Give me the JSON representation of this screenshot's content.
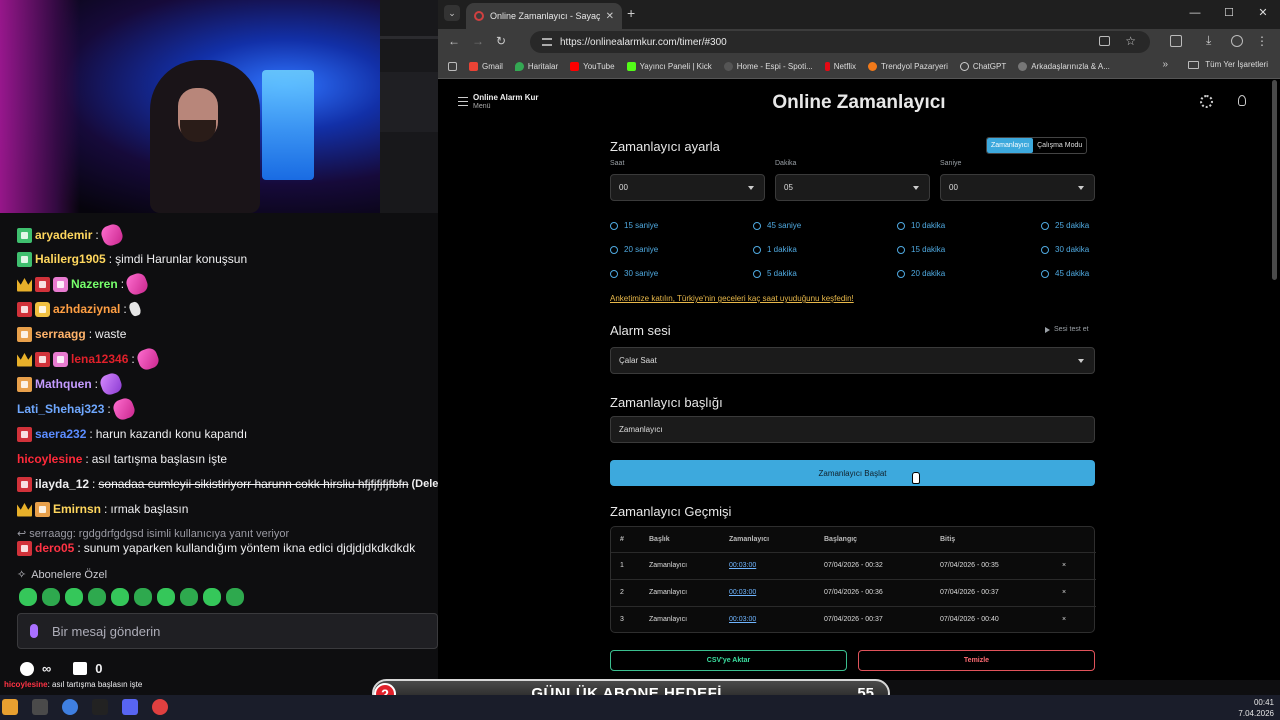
{
  "browser": {
    "tab_title": "Online Zamanlayıcı - Sayaç",
    "url": "https://onlinealarmkur.com/timer/#300",
    "bookmarks": [
      "Gmail",
      "Haritalar",
      "YouTube",
      "Yayıncı Paneli | Kick",
      "Home - Espi - Spoti...",
      "Netflix",
      "Trendyol Pazaryeri",
      "ChatGPT",
      "Arkadaşlarınızla & A..."
    ],
    "all_bookmarks": "Tüm Yer İşaretleri"
  },
  "page": {
    "brand": "Online Alarm Kur",
    "brand_sub": "Menü",
    "title": "Online Zamanlayıcı",
    "timer_heading": "Zamanlayıcı ayarla",
    "mode_timer": "Zamanlayıcı",
    "mode_work": "Çalışma Modu",
    "label_hour": "Saat",
    "label_minute": "Dakika",
    "label_second": "Saniye",
    "hour": "00",
    "minute": "05",
    "second": "00",
    "presets": [
      "15 saniye",
      "45 saniye",
      "10 dakika",
      "25 dakika",
      "20 saniye",
      "1 dakika",
      "15 dakika",
      "30 dakika",
      "30 saniye",
      "5 dakika",
      "20 dakika",
      "45 dakika"
    ],
    "survey_link": "Anketimize katılın, Türkiye'nin geceleri kaç saat uyuduğunu keşfedin!",
    "alarm_heading": "Alarm sesi",
    "test_sound": "Sesi test et",
    "alarm_sound": "Çalar Saat",
    "title_heading": "Zamanlayıcı başlığı",
    "title_value": "Zamanlayıcı",
    "start_button": "Zamanlayıcı Başlat",
    "history_heading": "Zamanlayıcı Geçmişi",
    "history_headers": [
      "#",
      "Başlık",
      "Zamanlayıcı",
      "Başlangıç",
      "Bitiş"
    ],
    "history_rows": [
      [
        "1",
        "Zamanlayıcı",
        "00:03:00",
        "07/04/2026 - 00:32",
        "07/04/2026 - 00:35"
      ],
      [
        "2",
        "Zamanlayıcı",
        "00:03:00",
        "07/04/2026 - 00:36",
        "07/04/2026 - 00:37"
      ],
      [
        "3",
        "Zamanlayıcı",
        "00:03:00",
        "07/04/2026 - 00:37",
        "07/04/2026 - 00:40"
      ]
    ],
    "delete_glyph": "×",
    "export_csv": "CSV'ye Aktar",
    "clear": "Temizle"
  },
  "chat": {
    "messages": [
      {
        "user": "aryademir",
        "text": "",
        "color": "#ffd75e"
      },
      {
        "user": "Halilerg1905",
        "text": "şimdi Harunlar konuşsun",
        "color": "#ffd75e"
      },
      {
        "user": "Nazeren",
        "text": "",
        "color": "#76ff6b"
      },
      {
        "user": "azhdaziynal",
        "text": "",
        "color": "#ff9f43"
      },
      {
        "user": "serraagg",
        "text": "waste",
        "color": "#ffb36b"
      },
      {
        "user": "lena12346",
        "text": "",
        "color": "#e0202a"
      },
      {
        "user": "Mathquen",
        "text": "",
        "color": "#c59bff"
      },
      {
        "user": "Lati_Shehaj323",
        "text": "",
        "color": "#6fa8ff"
      },
      {
        "user": "saera232",
        "text": "harun kazandı konu kapandı",
        "color": "#5b8cff"
      },
      {
        "user": "hicoylesine",
        "text": "asıl tartışma başlasın işte",
        "color": "#ff2a3a"
      },
      {
        "user": "ilayda_12",
        "text": "sonadaa cumleyii sikistiriyorr harunn cokk hirsliu hfjfjfjfjfbfn",
        "deleted": "(Deleted)",
        "color": "#efeff1"
      },
      {
        "user": "Emirnsn",
        "text": "ırmak başlasın",
        "color": "#ffd75e"
      },
      {
        "user": "dero05",
        "text": "sunum yaparken kullandığım yöntem ikna edici djdjdjdkdkdkdk",
        "color": "#ff3344"
      }
    ],
    "reply_preview": "serraagg: rgdgdrfgdgsd isimli kullanıcıya yanıt veriyor",
    "sub_only": "Abonelere Özel",
    "input_placeholder": "Bir mesaj gönderin",
    "stat_infinite": "∞",
    "stat_count": "0",
    "overlay_user": "hicoylesine",
    "overlay_text": "asıl tartışma başlasın işte"
  },
  "goal": {
    "current": "2",
    "title": "GÜNLÜK ABONE HEDEFİ",
    "target": "55"
  },
  "taskbar": {
    "time": "00:41",
    "date": "7.04.2026"
  }
}
